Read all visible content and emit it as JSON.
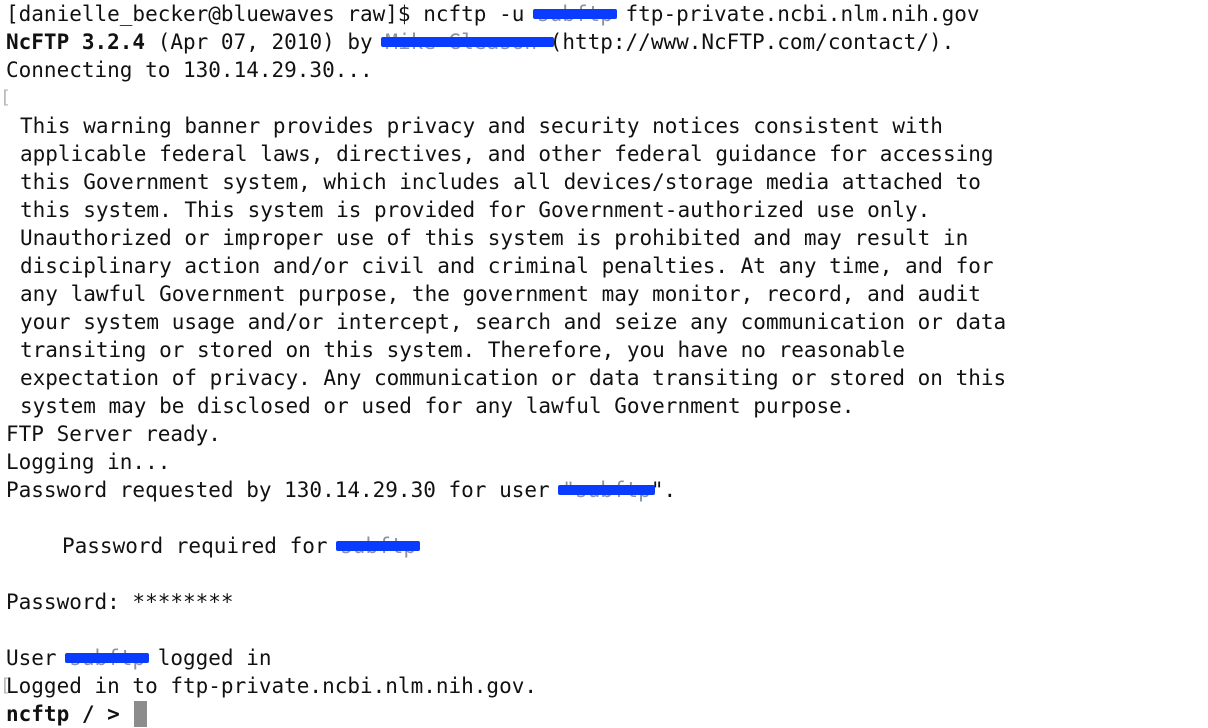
{
  "terminal": {
    "cmd_prefix": "[danielle_becker@bluewaves raw]$ ncftp -u ",
    "cmd_user_redacted": "subftp",
    "cmd_suffix": " ftp-private.ncbi.nlm.nih.gov",
    "ncftp_version": "NcFTP 3.2.4",
    "version_date": " (Apr 07, 2010) by ",
    "author_redacted": "Mike Gleason ",
    "author_url": "(http://www.NcFTP.com/contact/).",
    "connecting": "Connecting to 130.14.29.30...",
    "banner_lines": [
      "This warning banner provides privacy and security notices consistent with",
      "applicable federal laws, directives, and other federal guidance for accessing",
      "this Government system, which includes all devices/storage media attached to",
      "this system. This system is provided for Government-authorized use only.",
      "Unauthorized or improper use of this system is prohibited and may result in",
      "disciplinary action and/or civil and criminal penalties. At any time, and for",
      "any lawful Government purpose, the government may monitor, record, and audit",
      "your system usage and/or intercept, search and seize any communication or data",
      "transiting or stored on this system. Therefore, you have no reasonable",
      "expectation of privacy. Any communication or data transiting or stored on this",
      "system may be disclosed or used for any lawful Government purpose."
    ],
    "server_ready": "FTP Server ready.",
    "logging_in": "Logging in...",
    "pw_requested_prefix": "Password requested by 130.14.29.30 for user ",
    "pw_requested_user": "\"subftp",
    "pw_requested_suffix": "\".",
    "pw_required_prefix": "Password required for ",
    "pw_required_user": "subftp",
    "password_prompt": "Password: ********",
    "user_prefix": "User ",
    "user_redacted": "subftp",
    "user_suffix": " logged in",
    "logged_in_to": "Logged in to ftp-private.ncbi.nlm.nih.gov.",
    "prompt": "ncftp / > "
  },
  "colors": {
    "text": "#111111",
    "background": "#ffffff",
    "redaction": "#0a3cff",
    "cursor": "#8c8c8c"
  }
}
